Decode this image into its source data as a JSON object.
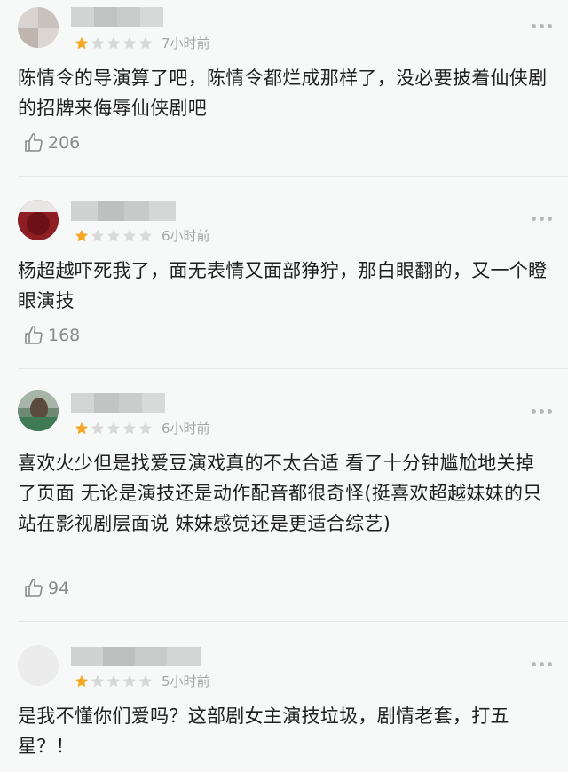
{
  "reviews": [
    {
      "rating": 1,
      "time": "7小时前",
      "text": "陈情令的导演算了吧，陈情令都烂成那样了，没必要披着仙侠剧的招牌来侮辱仙侠剧吧",
      "likes": "206"
    },
    {
      "rating": 1,
      "time": "6小时前",
      "text": "杨超越吓死我了，面无表情又面部狰狞，那白眼翻的，又一个瞪眼演技",
      "likes": "168"
    },
    {
      "rating": 1,
      "time": "6小时前",
      "text": "喜欢火少但是找爱豆演戏真的不太合适 看了十分钟尴尬地关掉了页面 无论是演技还是动作配音都很奇怪(挺喜欢超越妹妹的只站在影视剧层面说 妹妹感觉还是更适合综艺)",
      "likes": "94"
    },
    {
      "rating": 1,
      "time": "5小时前",
      "text": "是我不懂你们爱吗？这部剧女主演技垃圾，剧情老套，打五星？！",
      "likes": ""
    }
  ],
  "colors": {
    "star_on": "#f5a623",
    "star_off": "#d8d8d8",
    "time": "#a6a6a6"
  },
  "icons": {
    "like": "thumbs-up-icon",
    "more": "more-dots-icon",
    "star": "star-icon"
  }
}
